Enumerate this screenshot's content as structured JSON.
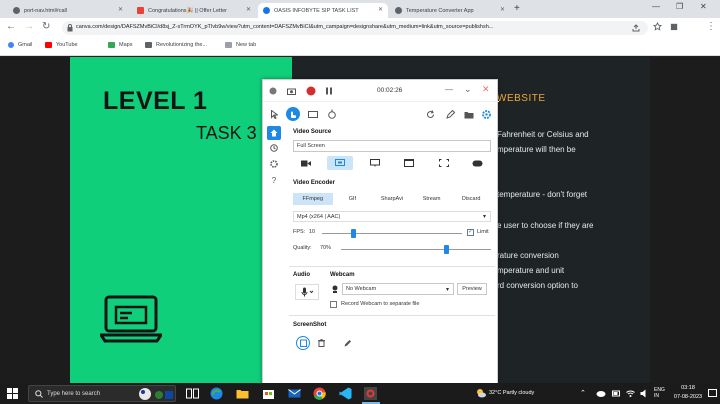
{
  "browser": {
    "tabs": [
      {
        "label": "port-nav.html#call",
        "color": "#5f6368"
      },
      {
        "label": "Congratulations🎉 || Offer Letter",
        "color": "#ea4335"
      },
      {
        "label": "OASIS INFOBYTE SIP TASK LIST",
        "color": "#1a73e8"
      },
      {
        "label": "Temperature Converter App",
        "color": "#5f6368"
      }
    ],
    "new_tab": "+",
    "url": "canva.com/design/DAFSZMvBiCI/d8sj_Z-sTrmOYK_pTIvb9w/view?utm_content=DAFSZMvBiCI&utm_campaign=designshare&utm_medium=link&utm_source=publishsh...",
    "avatar": "f",
    "bookmarks": [
      "Gmail",
      "YouTube",
      "Maps",
      "Revolutionizing the...",
      "New tab"
    ]
  },
  "page": {
    "level": "LEVEL 1",
    "task": "TASK 3",
    "right_heading": "WEBSITE",
    "right_lines": [
      "Fahrenheit or Celsius and",
      "mperature will then be",
      "temperature - don't forget",
      "e user to choose if they are",
      "rature conversion",
      "mperature and unit",
      "rd conversion option to"
    ]
  },
  "recorder": {
    "time": "00:02:26",
    "video_source_label": "Video Source",
    "video_source_value": "Full Screen",
    "video_encoder_label": "Video Encoder",
    "encoders": [
      "FFmpeg",
      "GIf",
      "SharpAvi",
      "Stream",
      "Discard"
    ],
    "selected_encoder": "FFmpeg",
    "format": "Mp4 (x264 | AAC)",
    "fps_label": "FPS:",
    "fps_value": "10",
    "limit_label": "Limit",
    "quality_label": "Quality:",
    "quality_value": "70%",
    "fps_level": 0.22,
    "quality_level": 0.7,
    "audio_label": "Audio",
    "webcam_label": "Webcam",
    "webcam_value": "No Webcam",
    "preview_label": "Preview",
    "record_webcam_label": "Record Webcam to separate file",
    "screenshot_label": "ScreenShot",
    "side_help": "?"
  },
  "taskbar": {
    "search_placeholder": "Type here to search",
    "weather": "32°C  Partly cloudy",
    "lang": "ENG\nIN",
    "time": "03:18",
    "date": "07-08-2023"
  },
  "colors": {
    "green": "#0fcf7a",
    "accent": "#1e88e5",
    "heading": "#f0a73a"
  }
}
